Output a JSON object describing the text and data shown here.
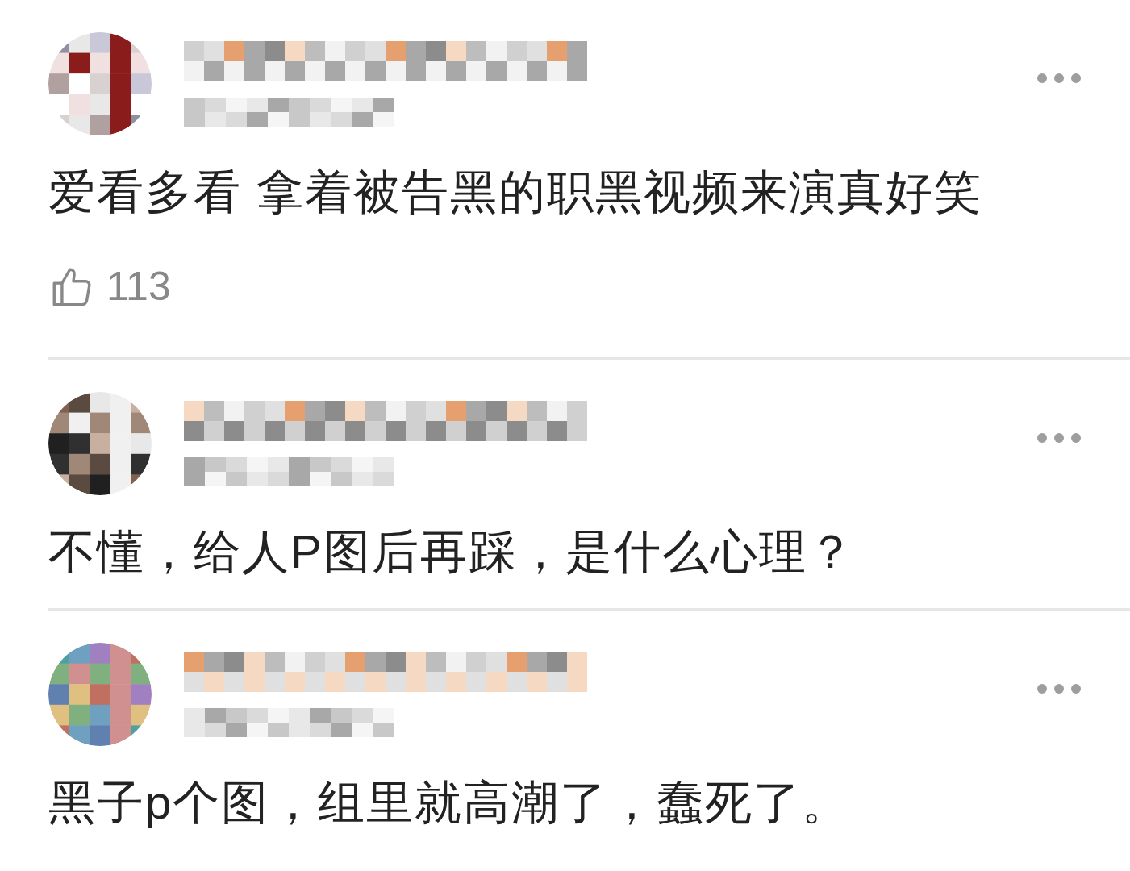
{
  "comments": [
    {
      "text": "爱看多看 拿着被告黑的职黑视频来演真好笑",
      "likes": "113"
    },
    {
      "text": "不懂，给人P图后再踩，是什么心理？"
    },
    {
      "text": "黑子p个图，组里就高潮了，蠢死了。"
    }
  ]
}
